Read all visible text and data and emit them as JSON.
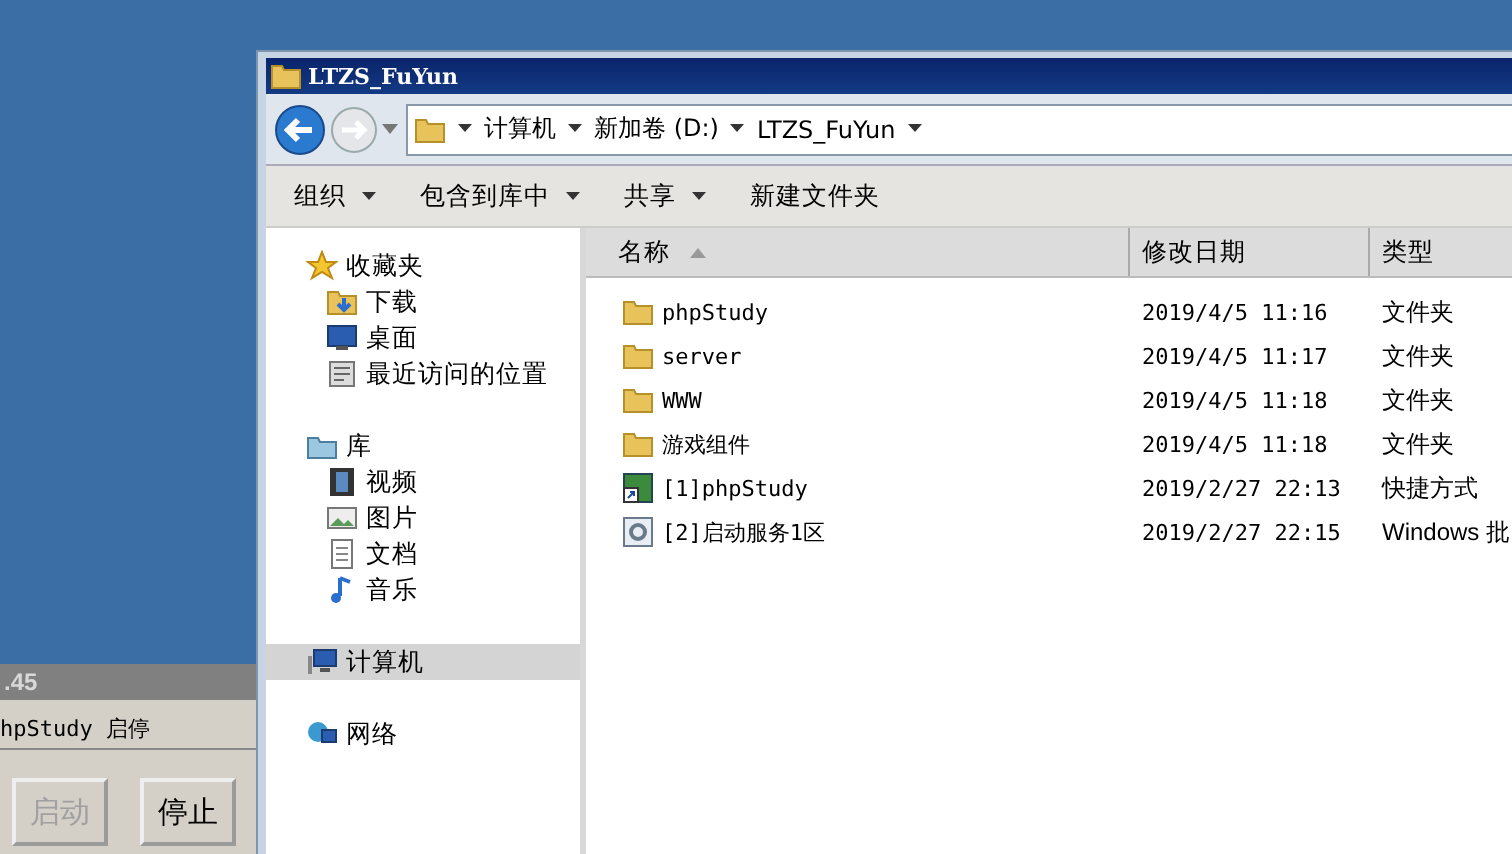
{
  "explorer": {
    "title": "LTZS_FuYun",
    "breadcrumb": [
      "计算机",
      "新加卷 (D:)",
      "LTZS_FuYun"
    ],
    "toolbar": [
      {
        "label": "组织",
        "dropdown": true
      },
      {
        "label": "包含到库中",
        "dropdown": true
      },
      {
        "label": "共享",
        "dropdown": true
      },
      {
        "label": "新建文件夹",
        "dropdown": false
      }
    ],
    "nav": [
      {
        "label": "收藏夹",
        "kind": "star",
        "selected": false,
        "children": [
          {
            "label": "下载",
            "kind": "download",
            "selected": false
          },
          {
            "label": "桌面",
            "kind": "desktop",
            "selected": false
          },
          {
            "label": "最近访问的位置",
            "kind": "recent",
            "selected": false
          }
        ]
      },
      {
        "label": "库",
        "kind": "library",
        "selected": false,
        "children": [
          {
            "label": "视频",
            "kind": "video",
            "selected": false
          },
          {
            "label": "图片",
            "kind": "picture",
            "selected": false
          },
          {
            "label": "文档",
            "kind": "document",
            "selected": false
          },
          {
            "label": "音乐",
            "kind": "music",
            "selected": false
          }
        ]
      },
      {
        "label": "计算机",
        "kind": "computer",
        "selected": true
      },
      {
        "label": "网络",
        "kind": "network",
        "selected": false
      }
    ],
    "columns": [
      {
        "label": "名称",
        "sorted": true
      },
      {
        "label": "修改日期",
        "sorted": false
      },
      {
        "label": "类型",
        "sorted": false
      }
    ],
    "rows": [
      {
        "name": "phpStudy",
        "date": "2019/4/5 11:16",
        "type": "文件夹",
        "kind": "folder"
      },
      {
        "name": "server",
        "date": "2019/4/5 11:17",
        "type": "文件夹",
        "kind": "folder"
      },
      {
        "name": "WWW",
        "date": "2019/4/5 11:18",
        "type": "文件夹",
        "kind": "folder"
      },
      {
        "name": "游戏组件",
        "date": "2019/4/5 11:18",
        "type": "文件夹",
        "kind": "folder"
      },
      {
        "name": "[1]phpStudy",
        "date": "2019/2/27 22:13",
        "type": "快捷方式",
        "kind": "shortcut"
      },
      {
        "name": "[2]启动服务1区",
        "date": "2019/2/27 22:15",
        "type": "Windows 批",
        "kind": "batch"
      }
    ]
  },
  "phpstudy": {
    "title": ".45",
    "group": "hpStudy 启停",
    "buttons": [
      {
        "label": "启动",
        "disabled": true
      },
      {
        "label": "停止",
        "disabled": false
      }
    ]
  }
}
